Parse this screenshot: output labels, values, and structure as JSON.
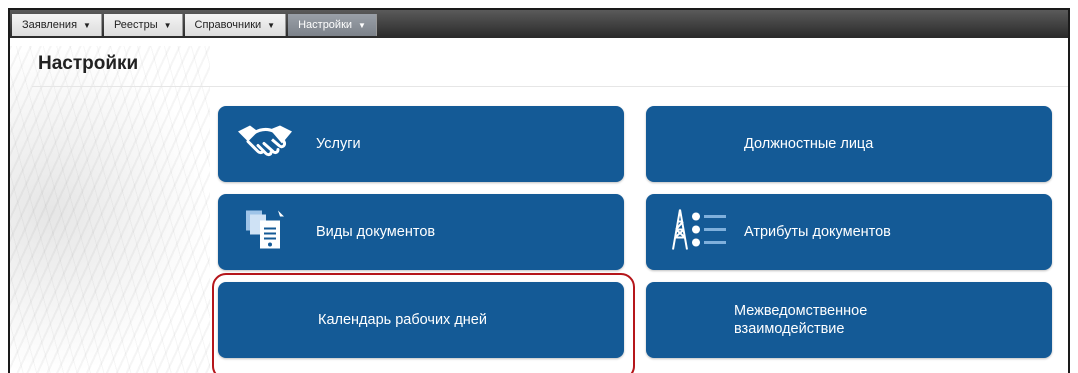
{
  "nav": {
    "items": [
      {
        "label": "Заявления",
        "caret": "▼",
        "active": false
      },
      {
        "label": "Реестры",
        "caret": "▼",
        "active": false
      },
      {
        "label": "Справочники",
        "caret": "▼",
        "active": false
      },
      {
        "label": "Настройки",
        "caret": "▼",
        "active": true
      }
    ]
  },
  "page": {
    "title": "Настройки"
  },
  "tiles": [
    {
      "label": "Услуги",
      "icon": "handshake-icon"
    },
    {
      "label": "Должностные лица",
      "icon": ""
    },
    {
      "label": "Виды документов",
      "icon": "documents-icon"
    },
    {
      "label": "Атрибуты документов",
      "icon": "tower-list-icon"
    },
    {
      "label": "Календарь рабочих дней",
      "icon": ""
    },
    {
      "label_line1": "Межведомственное",
      "label_line2": "взаимодействие",
      "icon": ""
    }
  ],
  "colors": {
    "tile": "#145a96",
    "highlight": "#b5161b",
    "active_tab": "#8a9099"
  }
}
